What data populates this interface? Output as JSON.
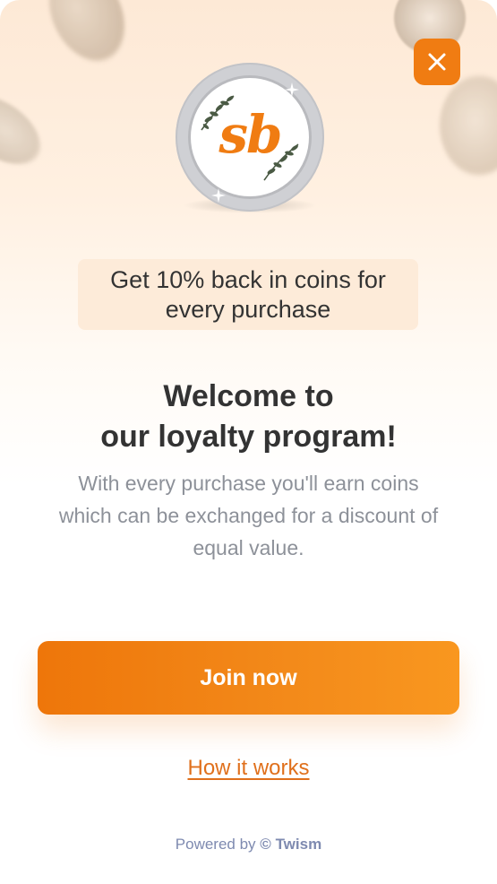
{
  "close_button": {
    "icon": "close-icon",
    "color": "#f07c12"
  },
  "logo": {
    "text": "sb",
    "accent_color": "#f07c12"
  },
  "promo": {
    "text": "Get 10% back in coins for every purchase"
  },
  "title": "Welcome to\nour loyalty program!",
  "description": "With every purchase you'll earn coins which can be exchanged for a discount of equal value.",
  "join_button": {
    "label": "Join now"
  },
  "how_link": {
    "label": "How it works"
  },
  "footer": {
    "prefix": "Powered by",
    "copyright_symbol": "©",
    "brand": "Twism"
  }
}
